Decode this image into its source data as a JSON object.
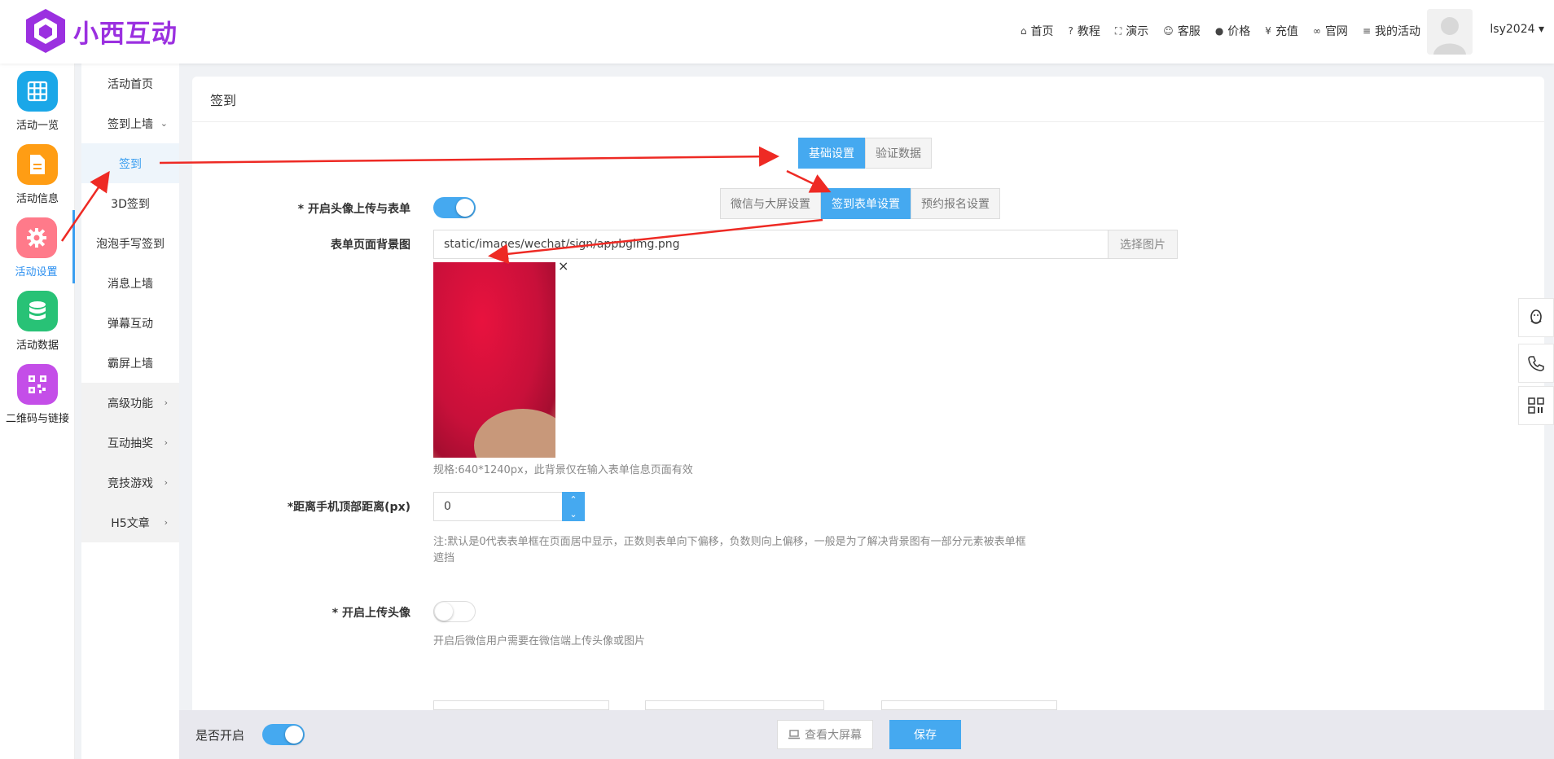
{
  "brand": {
    "name": "小西互动",
    "color": "#9b30e0"
  },
  "topnav": [
    {
      "icon": "home-icon",
      "glyph": "⌂",
      "label": "首页"
    },
    {
      "icon": "help-icon",
      "glyph": "?",
      "label": "教程"
    },
    {
      "icon": "fullscreen-icon",
      "glyph": "⛶",
      "label": "演示"
    },
    {
      "icon": "smile-icon",
      "glyph": "☺",
      "label": "客服"
    },
    {
      "icon": "info-icon",
      "glyph": "●",
      "label": "价格"
    },
    {
      "icon": "yen-icon",
      "glyph": "¥",
      "label": "充值"
    },
    {
      "icon": "link-icon",
      "glyph": "∞",
      "label": "官网"
    },
    {
      "icon": "list-icon",
      "glyph": "≡",
      "label": "我的活动"
    }
  ],
  "user": {
    "name": "lsy2024 ▾"
  },
  "icon_sidebar": [
    {
      "label": "活动一览",
      "color": "#1aa7e8",
      "icon": "grid-icon"
    },
    {
      "label": "活动信息",
      "color": "#ff9d14",
      "icon": "document-icon"
    },
    {
      "label": "活动设置",
      "color": "#ff7a8a",
      "icon": "gear-icon"
    },
    {
      "label": "活动数据",
      "color": "#28c276",
      "icon": "database-icon"
    },
    {
      "label": "二维码与链接",
      "color": "#c44ee8",
      "icon": "qrcode-icon"
    }
  ],
  "subnav": [
    {
      "label": "活动首页",
      "chev": ""
    },
    {
      "label": "签到上墙",
      "chev": "⌄"
    },
    {
      "label": "签到",
      "chev": ""
    },
    {
      "label": "3D签到",
      "chev": ""
    },
    {
      "label": "泡泡手写签到",
      "chev": ""
    },
    {
      "label": "消息上墙",
      "chev": ""
    },
    {
      "label": "弹幕互动",
      "chev": ""
    },
    {
      "label": "霸屏上墙",
      "chev": ""
    },
    {
      "label": "高级功能",
      "chev": "›"
    },
    {
      "label": "互动抽奖",
      "chev": "›"
    },
    {
      "label": "竞技游戏",
      "chev": "›"
    },
    {
      "label": "H5文章",
      "chev": "›"
    }
  ],
  "panel": {
    "title": "签到",
    "top_tabs": [
      "基础设置",
      "验证数据"
    ],
    "sub_tabs": [
      "微信与大屏设置",
      "签到表单设置",
      "预约报名设置"
    ],
    "avatar_upload_label": "* 开启头像上传与表单",
    "bg_label": "表单页面背景图",
    "bg_value": "static/images/wechat/sign/appbgimg.png",
    "choose_image": "选择图片",
    "close_glyph": "×",
    "spec_help": "规格:640*1240px，此背景仅在输入表单信息页面有效",
    "distance_label": "*距离手机顶部距离(px)",
    "distance_value": "0",
    "distance_help_1": "注:默认是0代表表单框在页面居中显示，正数则表单向下偏移，负数则向上偏移，一般是为了解决背景图有一部分元素被表单框",
    "distance_help_2": "遮挡",
    "upload_avatar_label": "* 开启上传头像",
    "upload_avatar_help": "开启后微信用户需要在微信端上传头像或图片",
    "spin_up": "⌃",
    "spin_down": "⌄"
  },
  "bottombar": {
    "enable_label": "是否开启",
    "view_screen": "查看大屏幕",
    "save": "保存"
  },
  "accent": "#45a9f0",
  "arrow_color": "#ee2a24"
}
